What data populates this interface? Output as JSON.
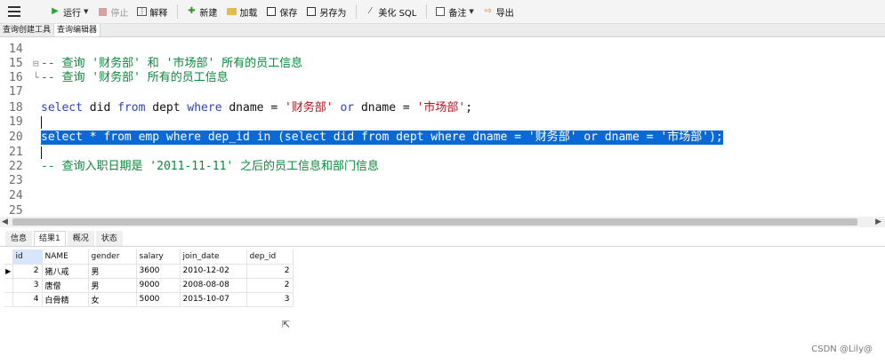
{
  "toolbar": {
    "buttons": [
      {
        "id": "run",
        "label": "运行",
        "icon": "play-icon",
        "color": "#2aa832"
      },
      {
        "id": "stop",
        "label": "停止",
        "icon": "stop-icon",
        "color": "#d23b3b"
      },
      {
        "id": "explain",
        "label": "解释",
        "icon": "explain-icon"
      },
      {
        "id": "new",
        "label": "新建",
        "icon": "new-icon"
      },
      {
        "id": "load",
        "label": "加载",
        "icon": "folder-icon"
      },
      {
        "id": "save",
        "label": "保存",
        "icon": "save-icon"
      },
      {
        "id": "saveas",
        "label": "另存为",
        "icon": "save-as-icon"
      },
      {
        "id": "beautify",
        "label": "美化 SQL",
        "icon": "magic-wand-icon"
      },
      {
        "id": "backup",
        "label": "备注",
        "icon": "note-icon"
      },
      {
        "id": "export",
        "label": "导出",
        "icon": "export-icon"
      }
    ]
  },
  "top_tabs": [
    "查询创建工具",
    "查询编辑器"
  ],
  "editor": {
    "lines": [
      {
        "n": "14",
        "text": ""
      },
      {
        "n": "15",
        "text": "-- 查询 '财务部' 和 '市场部' 所有的员工信息"
      },
      {
        "n": "16",
        "text": "-- 查询 '财务部' 所有的员工信息"
      },
      {
        "n": "17",
        "text": ""
      },
      {
        "n": "18",
        "parts": [
          "select",
          " did ",
          "from",
          " dept ",
          "where",
          " dname = ",
          "'财务部'",
          " ",
          "or",
          " dname = ",
          "'市场部'",
          ";"
        ]
      },
      {
        "n": "19",
        "text": ""
      },
      {
        "n": "20",
        "text": "select * from emp where dep_id in (select did from dept where dname = '财务部' or dname = '市场部');"
      },
      {
        "n": "21",
        "text": ""
      },
      {
        "n": "22",
        "text": "-- 查询入职日期是 '2011-11-11' 之后的员工信息和部门信息"
      },
      {
        "n": "23",
        "text": ""
      },
      {
        "n": "24",
        "text": ""
      },
      {
        "n": "25",
        "text": ""
      }
    ]
  },
  "bottom_tabs": [
    "信息",
    "结果1",
    "概况",
    "状态"
  ],
  "result": {
    "columns": [
      "id",
      "NAME",
      "gender",
      "salary",
      "join_date",
      "dep_id"
    ],
    "rows": [
      [
        "2",
        "猪八戒",
        "男",
        "3600",
        "2010-12-02",
        "2"
      ],
      [
        "3",
        "唐僧",
        "男",
        "9000",
        "2008-08-08",
        "2"
      ],
      [
        "4",
        "白骨精",
        "女",
        "5000",
        "2015-10-07",
        "3"
      ]
    ]
  },
  "watermark": "CSDN @Lily@",
  "colors": {
    "comment": "#0a8a3a",
    "keyword": "#2d3fbf",
    "string": "#b1121d",
    "selection": "#0a69d6"
  }
}
